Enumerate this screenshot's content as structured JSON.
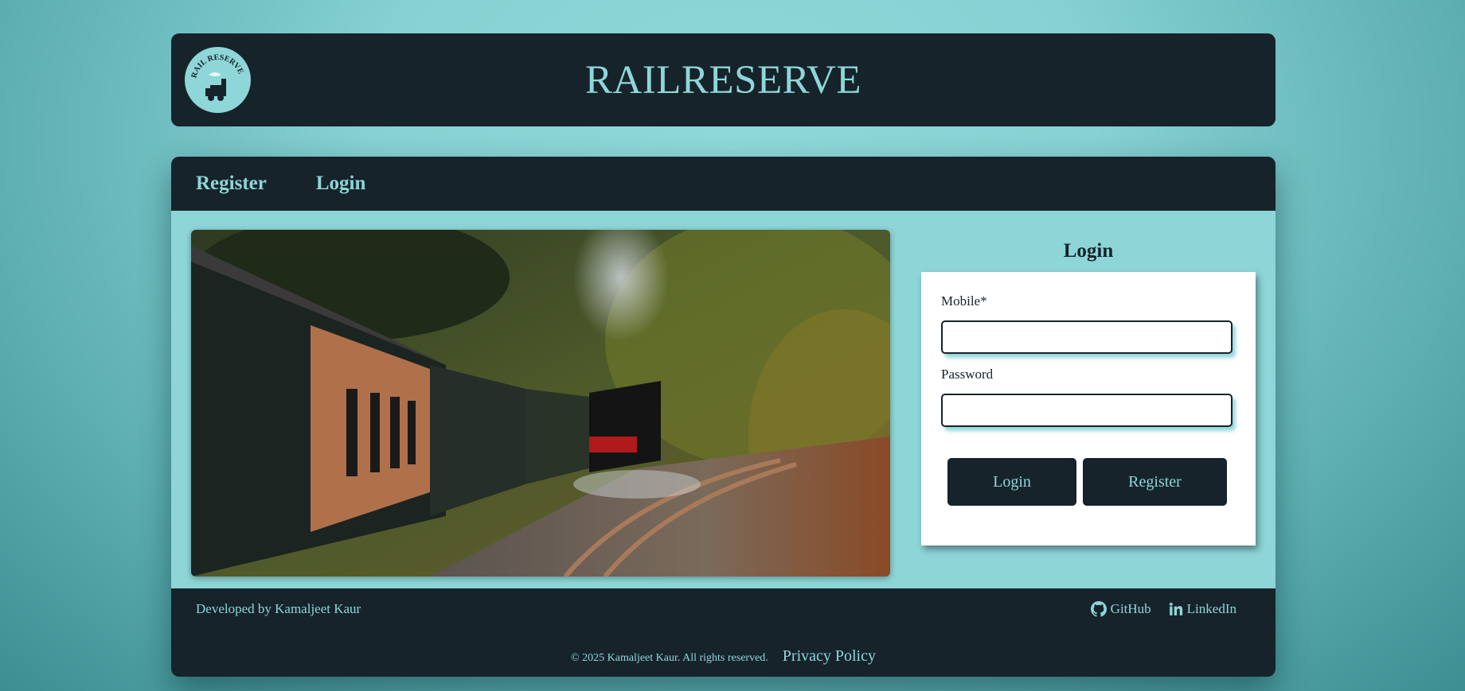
{
  "header": {
    "title": "RAILRESERVE",
    "logo_text": "RAIL RESERVE"
  },
  "nav": {
    "items": [
      {
        "label": "Register"
      },
      {
        "label": "Login"
      }
    ]
  },
  "login": {
    "title": "Login",
    "mobile_label": "Mobile*",
    "mobile_value": "",
    "password_label": "Password",
    "password_value": "",
    "login_button": "Login",
    "register_button": "Register"
  },
  "footer": {
    "developer": "Developed by Kamaljeet Kaur",
    "github": "GitHub",
    "linkedin": "LinkedIn",
    "copyright": "© 2025 Kamaljeet Kaur. All rights reserved.",
    "privacy": "Privacy Policy"
  },
  "colors": {
    "dark": "#16232b",
    "accent": "#8ed6d8",
    "background": "#8dd5d7"
  },
  "icons": [
    "logo-train-icon",
    "github-icon",
    "linkedin-icon"
  ]
}
